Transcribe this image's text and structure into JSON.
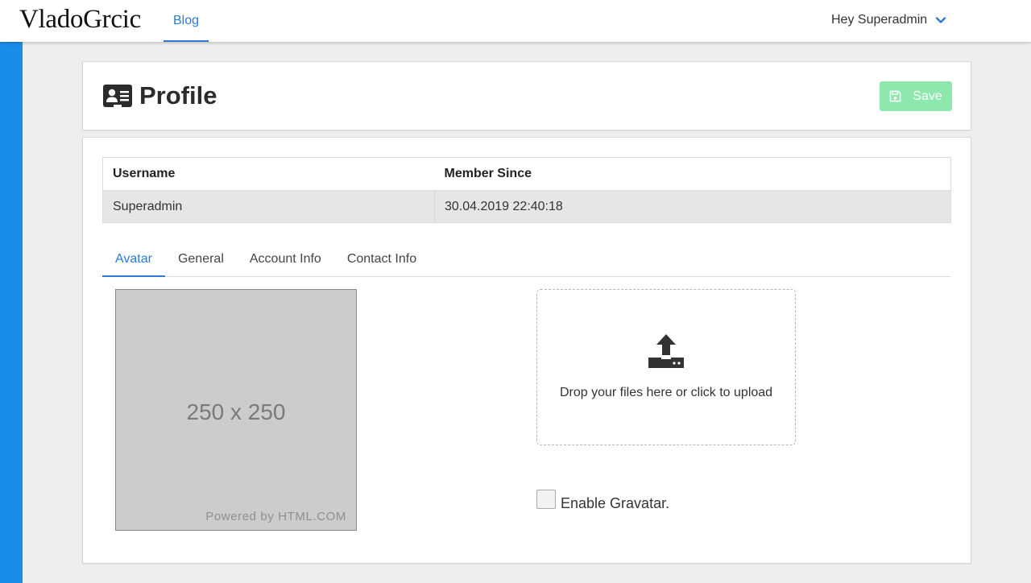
{
  "topbar": {
    "brand": "VladoGrcic",
    "nav_blog": "Blog",
    "user_greeting": "Hey Superadmin"
  },
  "header": {
    "title": "Profile",
    "save_label": "Save"
  },
  "info_table": {
    "headers": [
      "Username",
      "Member Since"
    ],
    "row": [
      "Superadmin",
      "30.04.2019 22:40:18"
    ]
  },
  "tabs": [
    {
      "label": "Avatar",
      "active": true
    },
    {
      "label": "General",
      "active": false
    },
    {
      "label": "Account Info",
      "active": false
    },
    {
      "label": "Contact Info",
      "active": false
    }
  ],
  "avatar": {
    "placeholder_size": "250 x 250",
    "powered_by": "Powered by HTML.COM"
  },
  "upload": {
    "text": "Drop your files here or click to upload"
  },
  "gravatar": {
    "label": "Enable Gravatar.",
    "checked": false
  },
  "colors": {
    "accent": "#2d7ad6",
    "sidebar": "#1a8de8",
    "save_button": "#8ee8ae"
  }
}
